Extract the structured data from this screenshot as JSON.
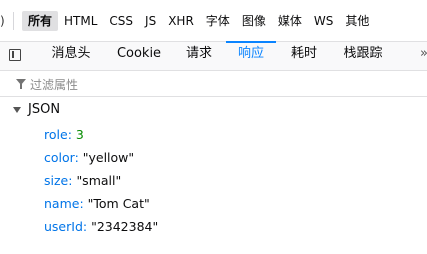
{
  "filterbar": {
    "left_cut": ")",
    "filters": [
      {
        "label": "所有",
        "active": true
      },
      {
        "label": "HTML",
        "active": false
      },
      {
        "label": "CSS",
        "active": false
      },
      {
        "label": "JS",
        "active": false
      },
      {
        "label": "XHR",
        "active": false
      },
      {
        "label": "字体",
        "active": false
      },
      {
        "label": "图像",
        "active": false
      },
      {
        "label": "媒体",
        "active": false
      },
      {
        "label": "WS",
        "active": false
      },
      {
        "label": "其他",
        "active": false
      }
    ]
  },
  "tabs": {
    "items": [
      {
        "label": "消息头",
        "selected": false
      },
      {
        "label": "Cookie",
        "selected": false
      },
      {
        "label": "请求",
        "selected": false
      },
      {
        "label": "响应",
        "selected": true
      },
      {
        "label": "耗时",
        "selected": false
      },
      {
        "label": "栈跟踪",
        "selected": false
      }
    ],
    "overflow_label": "»"
  },
  "prop_filter": {
    "placeholder": "过滤属性"
  },
  "json_tree": {
    "root_label": "JSON",
    "entries": [
      {
        "key": "role",
        "value": "3",
        "type": "number"
      },
      {
        "key": "color",
        "value": "\"yellow\"",
        "type": "string"
      },
      {
        "key": "size",
        "value": "\"small\"",
        "type": "string"
      },
      {
        "key": "name",
        "value": "\"Tom Cat\"",
        "type": "string"
      },
      {
        "key": "userId",
        "value": "\"2342384\"",
        "type": "string"
      }
    ]
  },
  "colors": {
    "accent": "#0a84ff",
    "key": "#0074e8",
    "number": "#058b00"
  }
}
